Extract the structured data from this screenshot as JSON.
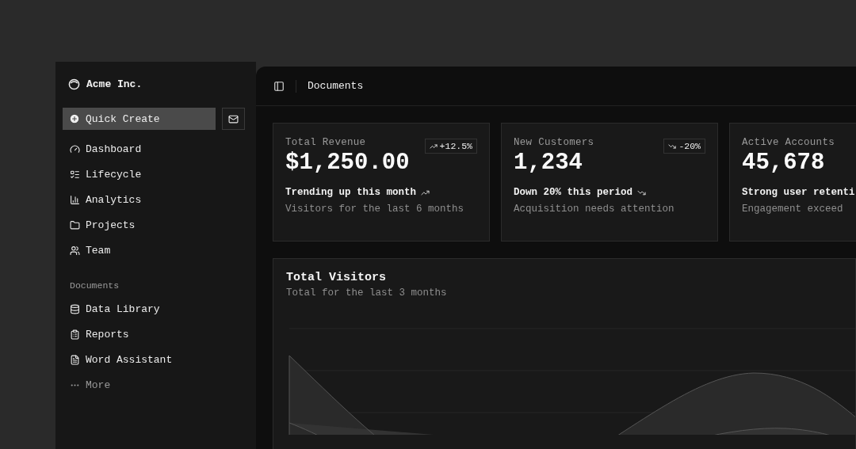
{
  "sidebar": {
    "brand": "Acme Inc.",
    "quick_create": "Quick Create",
    "nav": [
      {
        "label": "Dashboard"
      },
      {
        "label": "Lifecycle"
      },
      {
        "label": "Analytics"
      },
      {
        "label": "Projects"
      },
      {
        "label": "Team"
      }
    ],
    "documents_heading": "Documents",
    "documents": [
      {
        "label": "Data Library",
        "kind": "link"
      },
      {
        "label": "Reports",
        "kind": "link"
      },
      {
        "label": "Word Assistant",
        "kind": "link"
      },
      {
        "label": "More",
        "kind": "more"
      }
    ]
  },
  "header": {
    "title": "Documents"
  },
  "cards": [
    {
      "label": "Total Revenue",
      "value": "$1,250.00",
      "badge": "+12.5%",
      "rising": true,
      "headline": "Trending up this month",
      "note": "Visitors for the last 6 months"
    },
    {
      "label": "New Customers",
      "value": "1,234",
      "badge": "-20%",
      "rising": false,
      "headline": "Down 20% this period",
      "note": "Acquisition needs attention"
    },
    {
      "label": "Active Accounts",
      "value": "45,678",
      "headline": "Strong user retenti",
      "note": "Engagement exceed"
    }
  ],
  "chart_card": {
    "title": "Total Visitors",
    "subtitle": "Total for the last 3 months"
  }
}
